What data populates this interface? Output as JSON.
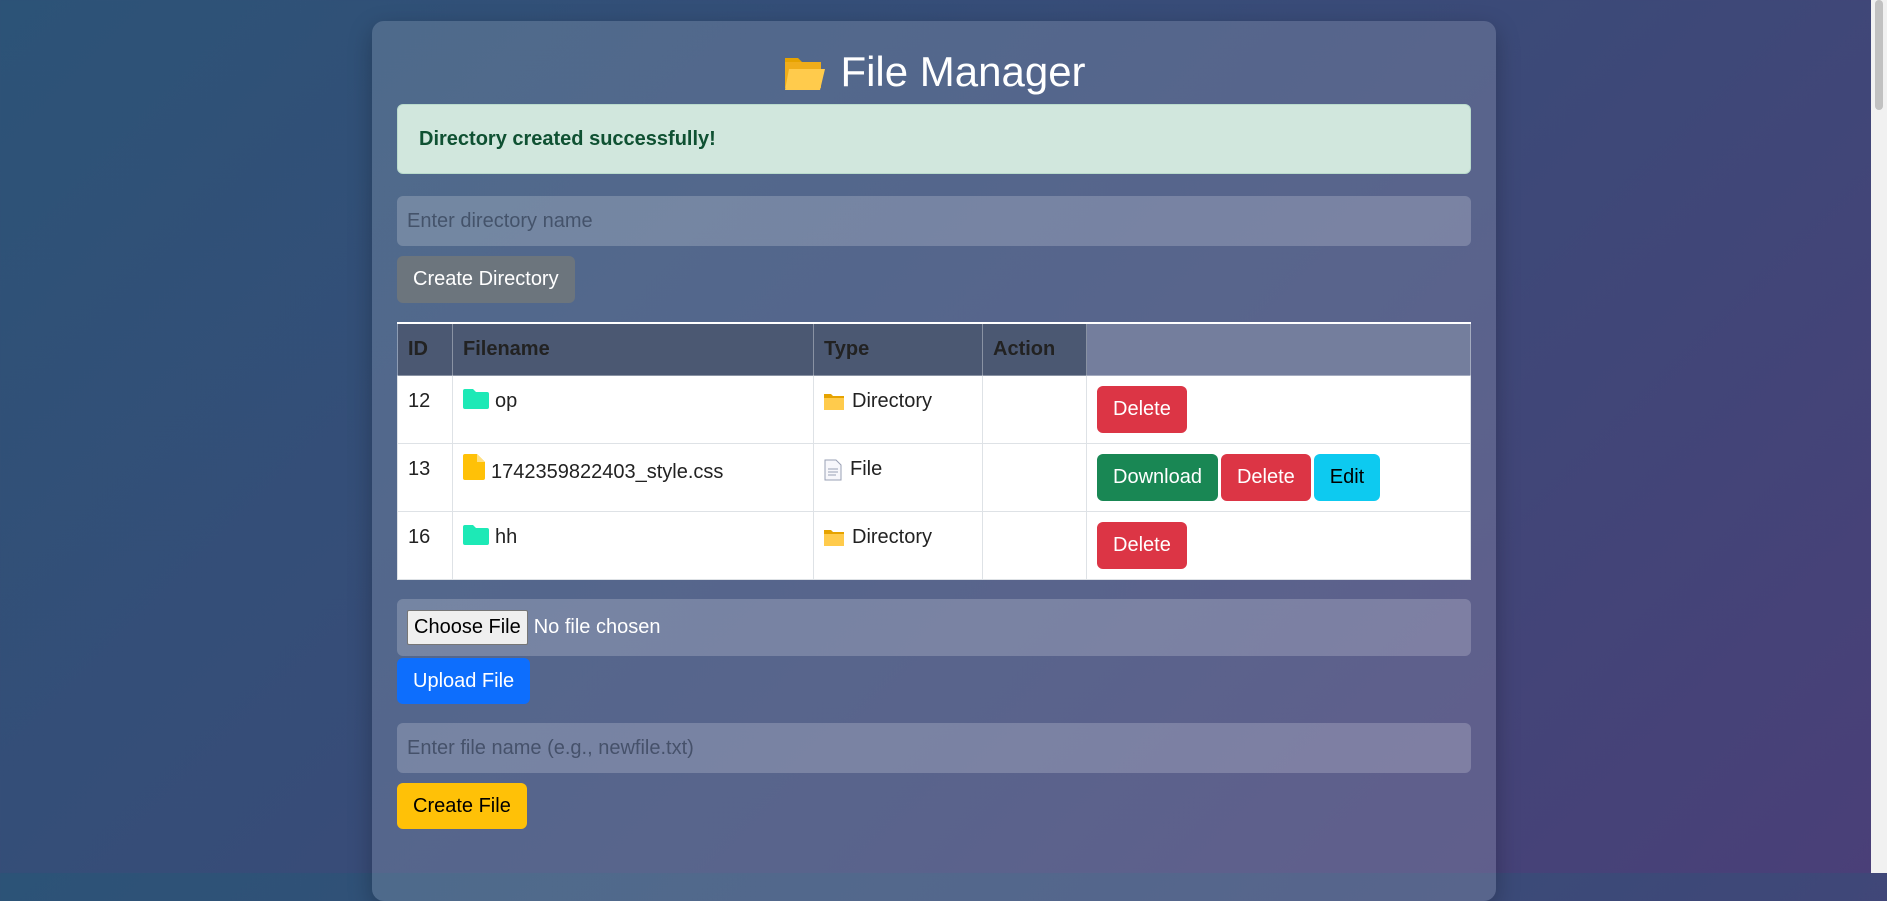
{
  "header": {
    "title": "File Manager",
    "icon": "open-folder-icon"
  },
  "alert": {
    "message": "Directory created successfully!"
  },
  "directory_form": {
    "placeholder": "Enter directory name",
    "value": "",
    "button_label": "Create Directory"
  },
  "table": {
    "headers": [
      "ID",
      "Filename",
      "Type",
      "Action",
      ""
    ],
    "rows": [
      {
        "id": "12",
        "filename": "op",
        "icon": "folder-icon",
        "type": "Directory",
        "type_icon": "folder-icon",
        "actions": [
          "Delete"
        ]
      },
      {
        "id": "13",
        "filename": "1742359822403_style.css",
        "icon": "file-icon",
        "type": "File",
        "type_icon": "document-icon",
        "actions": [
          "Download",
          "Delete",
          "Edit"
        ]
      },
      {
        "id": "16",
        "filename": "hh",
        "icon": "folder-icon",
        "type": "Directory",
        "type_icon": "folder-icon",
        "actions": [
          "Delete"
        ]
      }
    ]
  },
  "upload_form": {
    "choose_label": "Choose File",
    "status": "No file chosen",
    "button_label": "Upload File"
  },
  "file_form": {
    "placeholder": "Enter file name (e.g., newfile.txt)",
    "value": "",
    "button_label": "Create File"
  },
  "colors": {
    "danger": "#dc3545",
    "success": "#198754",
    "info": "#0dcaf0",
    "primary": "#0d6efd",
    "warning": "#ffc107",
    "secondary": "#6c757d",
    "folder_teal": "#1de9b6",
    "file_yellow": "#ffc107"
  }
}
